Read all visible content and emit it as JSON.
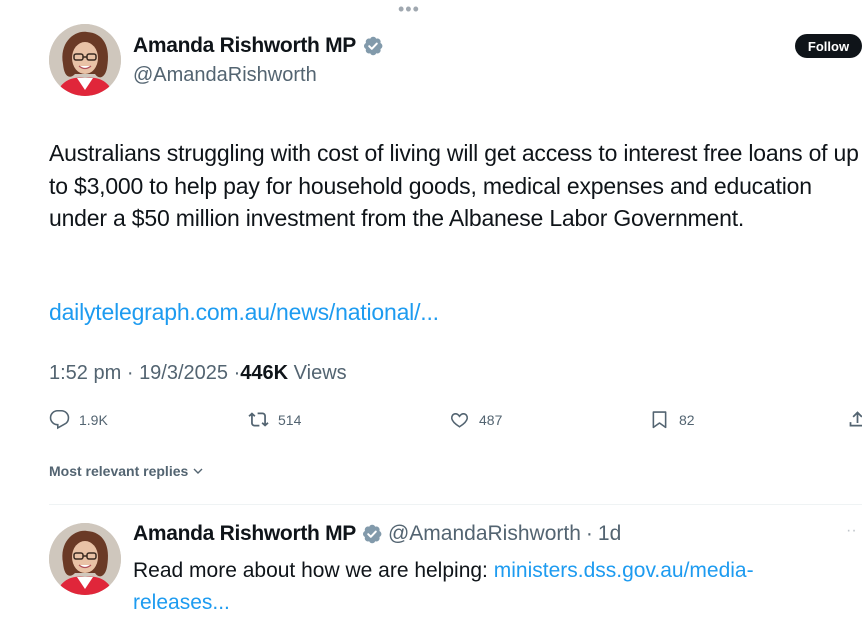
{
  "more_label": "•••",
  "tweet": {
    "author_name": "Amanda Rishworth MP",
    "author_handle": "@AmandaRishworth",
    "follow_label": "Follow",
    "text": "Australians struggling with cost of living will get access to interest free loans of up to $3,000 to help pay for household goods, medical expenses and education under a $50 million investment from the Albanese Labor Government.",
    "link": "dailytelegraph.com.au/news/national/...",
    "time": "1:52 pm",
    "date": "19/3/2025",
    "views_count": "446K",
    "views_label": "Views",
    "separator": "·",
    "replies": "1.9K",
    "reposts": "514",
    "likes": "487",
    "bookmarks": "82",
    "icons": {
      "reply": "reply-icon",
      "repost": "repost-icon",
      "like": "heart-icon",
      "bookmark": "bookmark-icon",
      "share": "share-icon",
      "verified": "verified-badge-icon"
    }
  },
  "replies_filter": {
    "label": "Most relevant replies"
  },
  "reply": {
    "author_name": "Amanda Rishworth MP",
    "author_handle": "@AmandaRishworth",
    "time": "1d",
    "separator": "·",
    "text": "Read more about how we are helping: ",
    "link": "ministers.dss.gov.au/media-releases..."
  },
  "colors": {
    "text": "#0f1419",
    "secondary": "#536471",
    "link": "#1d9bf0",
    "verified": "#829aab",
    "follow_bg": "#0f1419"
  }
}
